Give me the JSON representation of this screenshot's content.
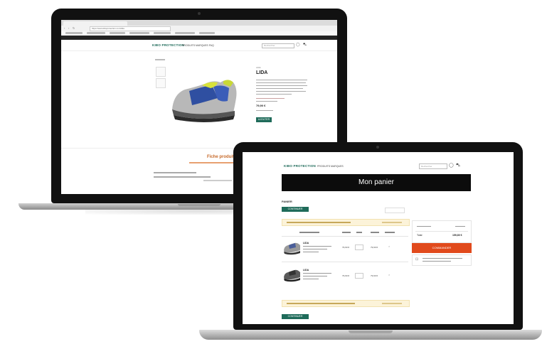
{
  "laptop_back": {
    "url_text": "https://www.kiloprotection.com/lida",
    "logo_text": "KIBO PROTECTION",
    "nav_text": "PRODUITS   MARQUES   FAQ",
    "search_placeholder": "Rechercher",
    "product_brand": "LIDA",
    "product_title": "LIDA",
    "price_text": "79,90 €",
    "add_button": "AJOUTER",
    "footer_heading": "Fiche produit"
  },
  "laptop_front": {
    "logo_text": "KIBO PROTECTION",
    "nav_text": "PRODUITS   MARQUES",
    "search_placeholder": "Rechercher",
    "cart_title": "Mon panier",
    "section_label": "PANIER",
    "continue_button": "CONTINUER",
    "checkout_button": "COMMANDER",
    "total_label": "Total",
    "total_value": "159,80 €",
    "items": [
      {
        "name": "LIDA",
        "price": "79,90 €",
        "total": "79,90 €"
      },
      {
        "name": "LIDA",
        "price": "79,90 €",
        "total": "79,90 €"
      }
    ]
  },
  "colors": {
    "accent_green": "#1f6b5a",
    "cta_orange": "#e14a1c",
    "banner_black": "#0c0c0c",
    "alert_yellow": "#fcf3d9"
  }
}
